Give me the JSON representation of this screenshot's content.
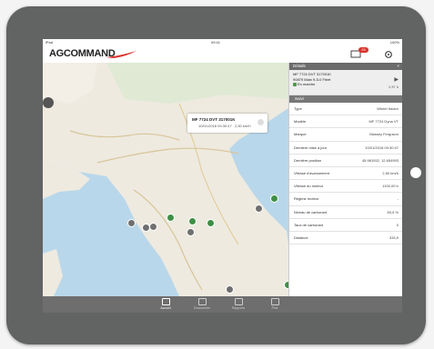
{
  "statusbar": {
    "left": "iPad",
    "center": "09:41",
    "right": "100%"
  },
  "header": {
    "logo": "AGCOMMAND",
    "notification_count": "25"
  },
  "panel": {
    "title": "Détails",
    "close": "×",
    "vehicle": {
      "line1": "MF 7724 DVT 317001K",
      "line2": "90879 Main 9-5-0 Fleet",
      "status": "En marche",
      "time": "1:37 h"
    },
    "tab": "Suivi",
    "rows": [
      {
        "k": "Type",
        "v": "Wheel tractor"
      },
      {
        "k": "Modèle",
        "v": "MF 7724 Dyna VT"
      },
      {
        "k": "Marque",
        "v": "Massey Ferguson"
      },
      {
        "k": "Dernière mise à jour",
        "v": "10/01/2018 09:30:47"
      },
      {
        "k": "Dernière position",
        "v": "45.981932, 12.654993"
      },
      {
        "k": "Vitesse d'avancement",
        "v": "2,50 km/h"
      },
      {
        "k": "Vitesse du moteur",
        "v": "1100,00 tr"
      },
      {
        "k": "Régime moteur",
        "v": "-"
      },
      {
        "k": "Niveau de carburant",
        "v": "83,5 %"
      },
      {
        "k": "Taux de carburant",
        "v": "0"
      },
      {
        "k": "Distance",
        "v": "333,9"
      }
    ]
  },
  "popup": {
    "title": "MF 7724 DVT 317001K",
    "date": "10/01/2018 09:30:47",
    "speed": "2,50 km/h"
  },
  "bottombar": {
    "items": [
      "Accueil",
      "Documents",
      "Rapports",
      "Plus"
    ]
  }
}
